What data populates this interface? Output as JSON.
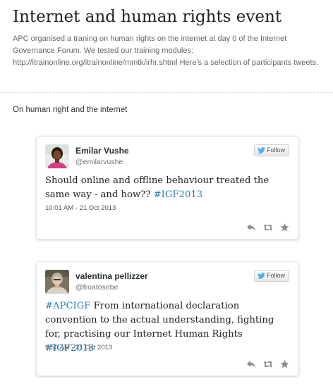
{
  "page": {
    "title": "Internet and human rights event",
    "description": "APC organised a traning on human rights on the internet at day 0 of the Internet Governance Forum. We tested our training modules: http://itrainonline.org/itrainonline/mmtk/irhr.shtml Here's a selection of participants tweets."
  },
  "section": {
    "heading": "On human right and the internet"
  },
  "tweets": [
    {
      "author": "Emilar Vushe",
      "handle": "@emilarvushe",
      "follow_label": "Follow",
      "text_before": "Should online and offline behaviour treated the same way  - and how?? ",
      "hashtag_1": "#IGF2013",
      "time": "10:01 AM - 21 Oct 2013"
    },
    {
      "author": "valentina pellizzer",
      "handle": "@froatosebe",
      "follow_label": "Follow",
      "hashtag_0": "#APCIGF",
      "text_body": " From international declaration convention to the actual understanding, fighting for, practising our Internet Human Rights ",
      "hashtag_1": "#IGF2013",
      "time": "9:50 AM - 21 Oct 2013"
    }
  ],
  "icons": {
    "bird": "twitter-bird-icon",
    "reply": "reply-icon",
    "retweet": "retweet-icon",
    "favorite": "star-icon"
  },
  "colors": {
    "hashtag": "#2a7fb6",
    "card_border": "#e1e8ed",
    "action_icon": "#8a8a8a"
  }
}
